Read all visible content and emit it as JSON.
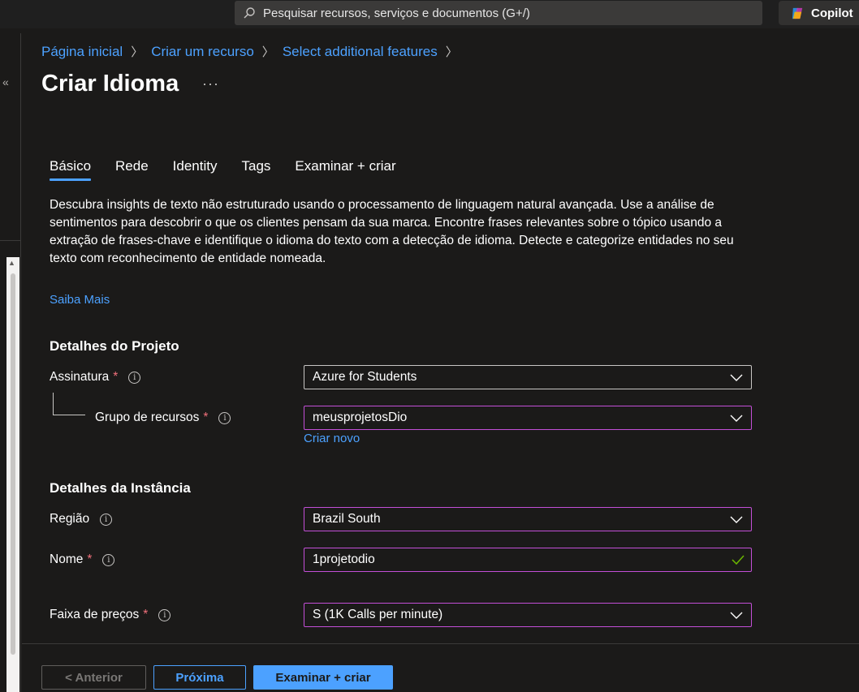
{
  "topbar": {
    "search_placeholder": "Pesquisar recursos, serviços e documentos (G+/)",
    "copilot_label": "Copilot"
  },
  "breadcrumb": [
    {
      "label": "Página inicial"
    },
    {
      "label": "Criar um recurso"
    },
    {
      "label": "Select additional features"
    }
  ],
  "page": {
    "title": "Criar Idioma",
    "more": "···"
  },
  "tabs": [
    {
      "label": "Básico",
      "active": true
    },
    {
      "label": "Rede"
    },
    {
      "label": "Identity"
    },
    {
      "label": "Tags"
    },
    {
      "label": "Examinar + criar"
    }
  ],
  "description": "Descubra insights de texto não estruturado usando o processamento de linguagem natural avançada. Use a análise de sentimentos para descobrir o que os clientes pensam da sua marca. Encontre frases relevantes sobre o tópico usando a extração de frases-chave e identifique o idioma do texto com a detecção de idioma. Detecte e categorize entidades no seu texto com reconhecimento de entidade nomeada.",
  "learn_more": "Saiba Mais",
  "project": {
    "title": "Detalhes do Projeto",
    "subscription": {
      "label": "Assinatura",
      "required": "*",
      "value": "Azure for Students"
    },
    "resource_group": {
      "label": "Grupo de recursos",
      "required": "*",
      "value": "meusprojetosDio",
      "create_new": "Criar novo"
    }
  },
  "instance": {
    "title": "Detalhes da Instância",
    "region": {
      "label": "Região",
      "value": "Brazil South"
    },
    "name": {
      "label": "Nome",
      "required": "*",
      "value": "1projetodio"
    },
    "pricing": {
      "label": "Faixa de preços",
      "required": "*",
      "value": "S (1K Calls per minute)"
    }
  },
  "footer": {
    "prev": "< Anterior",
    "next": "Próxima",
    "review": "Examinar + criar"
  },
  "colors": {
    "accent": "#4ca1ff",
    "required": "#f1707b",
    "focus_border": "#c34fd7",
    "valid": "#6bb700"
  }
}
